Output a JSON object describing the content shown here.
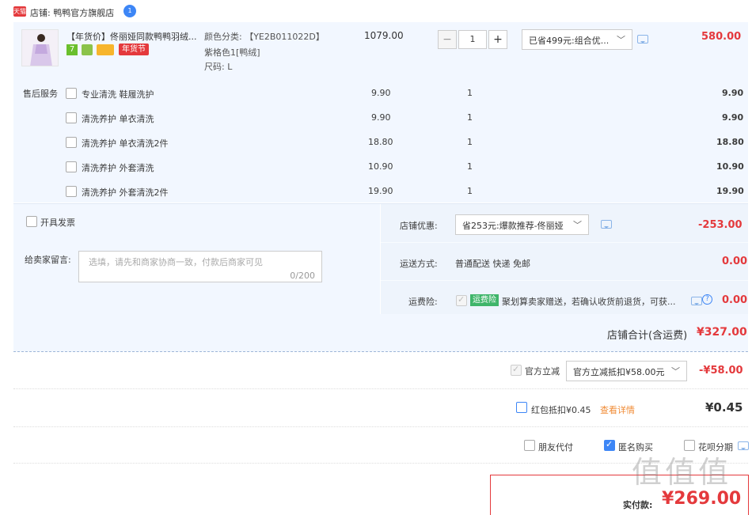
{
  "store": {
    "badge": "天猫",
    "label": "店铺: 鸭鸭官方旗舰店",
    "count": "1"
  },
  "product": {
    "title": "【年货价】佟丽娅同款鸭鸭羽绒...",
    "tag_sale": "年货节",
    "tag_seven": "7",
    "spec_color": "颜色分类: 【YE2B011022D】",
    "spec_color2": "紫格色1[鸭绒]",
    "spec_size": "尺码: L",
    "unit_price": "1079.00",
    "quantity": "1",
    "minus": "−",
    "plus": "+",
    "promo_select": "已省499元:组合优...",
    "total": "580.00"
  },
  "after_sales": {
    "label": "售后服务",
    "items": [
      {
        "name": "专业清洗 鞋履洗护",
        "price": "9.90",
        "qty": "1",
        "total": "9.90"
      },
      {
        "name": "清洗养护 单衣清洗",
        "price": "9.90",
        "qty": "1",
        "total": "9.90"
      },
      {
        "name": "清洗养护 单衣清洗2件",
        "price": "18.80",
        "qty": "1",
        "total": "18.80"
      },
      {
        "name": "清洗养护 外套清洗",
        "price": "10.90",
        "qty": "1",
        "total": "10.90"
      },
      {
        "name": "清洗养护 外套清洗2件",
        "price": "19.90",
        "qty": "1",
        "total": "19.90"
      }
    ]
  },
  "invoice": {
    "label": "开具发票"
  },
  "message": {
    "label": "给卖家留言:",
    "placeholder": "选填，请先和商家协商一致，付款后商家可见",
    "counter": "0/200"
  },
  "store_discount": {
    "label": "店铺优惠:",
    "select": "省253元:爆款推荐-佟丽娅",
    "amount": "-253.00"
  },
  "shipping": {
    "label": "运送方式:",
    "value": "普通配送 快递 免邮",
    "amount": "0.00"
  },
  "insurance": {
    "label": "运费险:",
    "badge": "运费险",
    "text": "聚划算卖家赠送，若确认收货前退货，可获...",
    "amount": "0.00"
  },
  "store_total": {
    "label": "店铺合计(含运费)",
    "amount": "¥327.00"
  },
  "official_discount": {
    "label": "官方立减",
    "select": "官方立减抵扣¥58.00元",
    "amount": "-¥58.00"
  },
  "red_packet": {
    "label": "红包抵扣¥0.45",
    "link": "查看详情",
    "amount": "¥0.45"
  },
  "options": {
    "friend_pay": "朋友代付",
    "anonymous": "匿名购买",
    "huabei": "花呗分期"
  },
  "actual_pay": {
    "label": "实付款:",
    "amount": "¥269.00"
  },
  "watermark": "值 值 值"
}
